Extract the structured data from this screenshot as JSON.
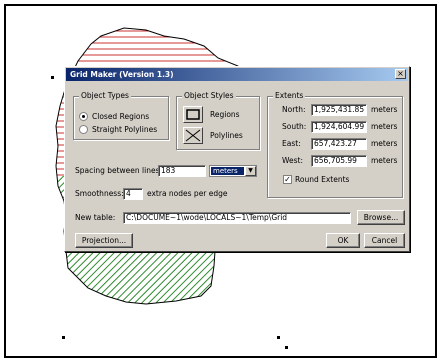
{
  "dialog": {
    "title": "Grid Maker (Version 1.3)",
    "close_glyph": "×"
  },
  "object_types": {
    "legend": "Object Types",
    "options": [
      "Closed Regions",
      "Straight Polylines"
    ],
    "selected": "Closed Regions"
  },
  "object_styles": {
    "legend": "Object Styles",
    "regions_label": "Regions",
    "polylines_label": "Polylines"
  },
  "extents": {
    "legend": "Extents",
    "rows": [
      {
        "label": "North:",
        "value": "1,925,431.85",
        "unit": "meters"
      },
      {
        "label": "South:",
        "value": "1,924,604.99",
        "unit": "meters"
      },
      {
        "label": "East:",
        "value": "657,423.27",
        "unit": "meters"
      },
      {
        "label": "West:",
        "value": "656,705.99",
        "unit": "meters"
      }
    ],
    "round_extents_label": "Round Extents",
    "round_extents_checked": true
  },
  "spacing": {
    "label": "Spacing between lines:",
    "value": "183",
    "unit_selected": "meters"
  },
  "smoothness": {
    "label": "Smoothness:",
    "value": "4",
    "suffix": "extra nodes per edge"
  },
  "new_table": {
    "label": "New table:",
    "value": "C:\\DOCUME~1\\wode\\LOCALS~1\\Temp\\Grid"
  },
  "buttons": {
    "browse": "Browse...",
    "projection": "Projection...",
    "ok": "OK",
    "cancel": "Cancel"
  },
  "colors": {
    "title_bar_start": "#0a246a",
    "title_bar_end": "#a6caf0",
    "dialog_face": "#d4d0c8",
    "region_hatch_red": "#cc3333",
    "region_hatch_green": "#2e8b2e"
  },
  "icons": [
    "close-icon",
    "region-style-icon",
    "polyline-style-icon",
    "dropdown-arrow-icon",
    "checkmark-icon"
  ]
}
